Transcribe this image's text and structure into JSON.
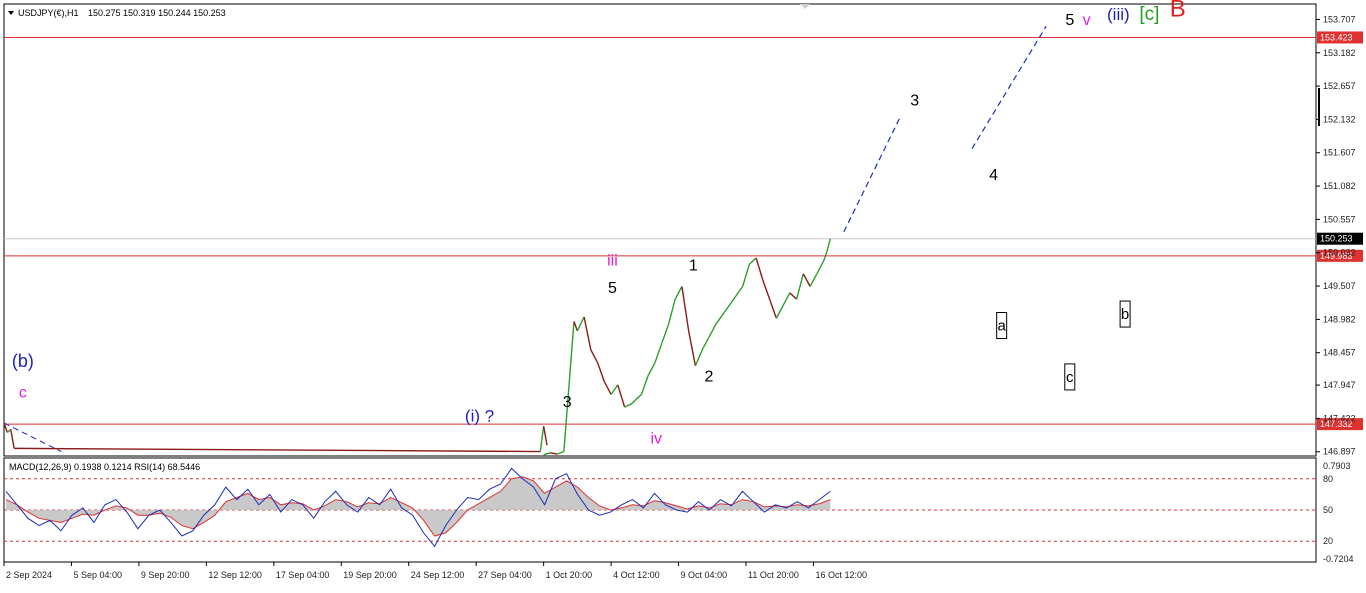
{
  "header": {
    "symbol": "USDJPY(€),H1",
    "ohlc": "150.275 150.319 150.244 150.253"
  },
  "indicator_header": "MACD(12,26,9) 0.1938 0.1214 RSI(14) 68.5446",
  "colors": {
    "bull": "#2e9e2e",
    "bear": "#8b1a1a",
    "level": "#e03030",
    "projection": "#1a2fb8",
    "rsi": "#1a2fb8",
    "macd_signal": "#e03030",
    "macd_hist": "#c0c0c0",
    "wave_black": "#000000",
    "wave_magenta": "#e020e0",
    "wave_blue": "#2020c0",
    "wave_green": "#20a020",
    "wave_red": "#e02020"
  },
  "chart_data": [
    {
      "type": "line",
      "title": "",
      "price_axis": {
        "ticks": [
          153.707,
          153.182,
          152.657,
          152.132,
          151.607,
          151.082,
          150.557,
          150.032,
          149.507,
          148.982,
          148.457,
          147.947,
          147.422,
          146.897
        ],
        "tick_labels": [
          "153.707",
          "153.182",
          "152.657",
          "152.132",
          "151.607",
          "151.082",
          "150.557",
          "150.032",
          "149.507",
          "148.982",
          "148.457",
          "147.947",
          "147.422",
          "146.897"
        ],
        "range": [
          146.83,
          153.95
        ]
      },
      "time_axis": {
        "labels": [
          "2 Sep 2024",
          "5 Sep 04:00",
          "9 Sep 20:00",
          "12 Sep 12:00",
          "17 Sep 04:00",
          "19 Sep 20:00",
          "24 Sep 12:00",
          "27 Sep 04:00",
          "1 Oct 20:00",
          "4 Oct 12:00",
          "9 Oct 04:00",
          "11 Oct 20:00",
          "16 Oct 12:00"
        ],
        "positions": [
          0,
          1,
          2,
          3,
          4,
          5,
          6,
          7,
          8,
          9,
          10,
          11,
          12
        ],
        "range": [
          0,
          19.45
        ]
      },
      "horizontal_levels": [
        {
          "value": 153.423,
          "label": "153.423"
        },
        {
          "value": 149.983,
          "label": "149.983"
        },
        {
          "value": 147.332,
          "label": "147.332"
        }
      ],
      "current_price": {
        "value": 150.253,
        "label": "150.253"
      },
      "price_path": [
        [
          8.0,
          146.85
        ],
        [
          8.1,
          146.88
        ],
        [
          8.2,
          146.86
        ],
        [
          8.3,
          146.9
        ],
        [
          8.45,
          148.95
        ],
        [
          8.5,
          148.8
        ],
        [
          8.6,
          149.02
        ],
        [
          8.7,
          148.5
        ],
        [
          8.8,
          148.3
        ],
        [
          8.9,
          148.0
        ],
        [
          9.0,
          147.8
        ],
        [
          9.1,
          147.95
        ],
        [
          9.2,
          147.6
        ],
        [
          9.3,
          147.65
        ],
        [
          9.45,
          147.8
        ],
        [
          9.55,
          148.1
        ],
        [
          9.65,
          148.3
        ],
        [
          9.75,
          148.6
        ],
        [
          9.85,
          148.9
        ],
        [
          9.95,
          149.3
        ],
        [
          10.05,
          149.5
        ],
        [
          10.15,
          148.8
        ],
        [
          10.25,
          148.25
        ],
        [
          10.35,
          148.5
        ],
        [
          10.45,
          148.7
        ],
        [
          10.55,
          148.9
        ],
        [
          10.65,
          149.05
        ],
        [
          10.75,
          149.2
        ],
        [
          10.85,
          149.35
        ],
        [
          10.95,
          149.5
        ],
        [
          11.05,
          149.85
        ],
        [
          11.15,
          149.95
        ],
        [
          11.25,
          149.6
        ],
        [
          11.35,
          149.3
        ],
        [
          11.45,
          149.0
        ],
        [
          11.55,
          149.2
        ],
        [
          11.65,
          149.4
        ],
        [
          11.75,
          149.3
        ],
        [
          11.85,
          149.7
        ],
        [
          11.95,
          149.5
        ],
        [
          12.05,
          149.7
        ],
        [
          12.15,
          149.9
        ],
        [
          12.2,
          150.05
        ],
        [
          12.25,
          150.253
        ]
      ],
      "pre_breakout_path": [
        [
          0.0,
          147.35
        ],
        [
          0.05,
          147.2
        ],
        [
          0.1,
          147.25
        ],
        [
          0.15,
          146.95
        ],
        [
          7.95,
          146.9
        ],
        [
          8.0,
          147.3
        ],
        [
          8.05,
          147.0
        ]
      ],
      "projection_segments": [
        [
          [
            12.45,
            150.36
          ],
          [
            13.3,
            152.2
          ]
        ],
        [
          [
            14.35,
            151.67
          ],
          [
            15.45,
            153.6
          ]
        ]
      ],
      "wave_labels": [
        {
          "text": "(b)",
          "x": 0.28,
          "y": 148.23,
          "color": "wave_blue",
          "size": 18
        },
        {
          "text": "c",
          "x": 0.28,
          "y": 147.75,
          "color": "wave_magenta",
          "size": 16
        },
        {
          "text": "(i) ?",
          "x": 7.05,
          "y": 147.37,
          "color": "wave_blue",
          "size": 17
        },
        {
          "text": "3",
          "x": 8.35,
          "y": 147.6,
          "color": "wave_black",
          "size": 16
        },
        {
          "text": "5",
          "x": 9.02,
          "y": 149.4,
          "color": "wave_black",
          "size": 16
        },
        {
          "text": "iii",
          "x": 9.02,
          "y": 149.83,
          "color": "wave_magenta",
          "size": 16
        },
        {
          "text": "iv",
          "x": 9.67,
          "y": 147.03,
          "color": "wave_magenta",
          "size": 16
        },
        {
          "text": "1",
          "x": 10.22,
          "y": 149.75,
          "color": "wave_black",
          "size": 16
        },
        {
          "text": "2",
          "x": 10.45,
          "y": 148.0,
          "color": "wave_black",
          "size": 16
        },
        {
          "text": "3",
          "x": 13.5,
          "y": 152.35,
          "color": "wave_black",
          "size": 16
        },
        {
          "text": "4",
          "x": 14.67,
          "y": 151.18,
          "color": "wave_black",
          "size": 16
        },
        {
          "text": "5",
          "x": 15.8,
          "y": 153.62,
          "color": "wave_black",
          "size": 16
        },
        {
          "text": "v",
          "x": 16.05,
          "y": 153.62,
          "color": "wave_magenta",
          "size": 16
        },
        {
          "text": "(iii)",
          "x": 16.52,
          "y": 153.7,
          "color": "wave_blue",
          "size": 17
        },
        {
          "text": "[c]",
          "x": 16.98,
          "y": 153.7,
          "color": "wave_green",
          "size": 19
        },
        {
          "text": "B",
          "x": 17.4,
          "y": 153.75,
          "color": "wave_red",
          "size": 24
        }
      ],
      "boxed_labels": [
        {
          "text": "a",
          "x": 14.79,
          "y": 148.87
        },
        {
          "text": "c",
          "x": 15.8,
          "y": 148.06
        },
        {
          "text": "b",
          "x": 16.62,
          "y": 149.05
        }
      ]
    },
    {
      "type": "line",
      "title": "",
      "axis": {
        "ticks": [
          0.7903,
          80,
          50,
          20,
          -0.7204
        ],
        "tick_labels": [
          "0.7903",
          "80",
          "50",
          "20",
          "-0.7204"
        ]
      },
      "rsi_range": [
        0,
        100
      ],
      "rsi_levels": [
        80,
        50,
        20
      ],
      "series": [
        {
          "key": "rsi",
          "values": [
            68,
            55,
            42,
            35,
            40,
            30,
            45,
            52,
            38,
            55,
            60,
            48,
            32,
            45,
            50,
            38,
            25,
            30,
            45,
            55,
            72,
            60,
            70,
            55,
            65,
            48,
            60,
            55,
            42,
            58,
            68,
            55,
            48,
            62,
            55,
            70,
            52,
            45,
            28,
            15,
            35,
            50,
            62,
            60,
            70,
            75,
            90,
            80,
            72,
            55,
            80,
            85,
            65,
            50,
            45,
            48,
            55,
            60,
            52,
            66,
            55,
            50,
            48,
            58,
            50,
            60,
            54,
            68,
            58,
            48,
            55,
            52,
            58,
            52,
            60,
            68
          ]
        },
        {
          "key": "macd_signal",
          "values": [
            60,
            55,
            48,
            42,
            40,
            38,
            42,
            46,
            45,
            50,
            54,
            52,
            45,
            45,
            47,
            43,
            35,
            32,
            38,
            45,
            58,
            62,
            66,
            60,
            62,
            55,
            57,
            56,
            50,
            54,
            60,
            58,
            53,
            57,
            56,
            62,
            57,
            52,
            40,
            25,
            28,
            38,
            50,
            56,
            62,
            68,
            80,
            82,
            78,
            66,
            72,
            78,
            72,
            62,
            54,
            50,
            52,
            55,
            54,
            59,
            57,
            54,
            51,
            54,
            52,
            56,
            55,
            60,
            58,
            53,
            54,
            53,
            55,
            54,
            56,
            60
          ]
        }
      ]
    }
  ]
}
